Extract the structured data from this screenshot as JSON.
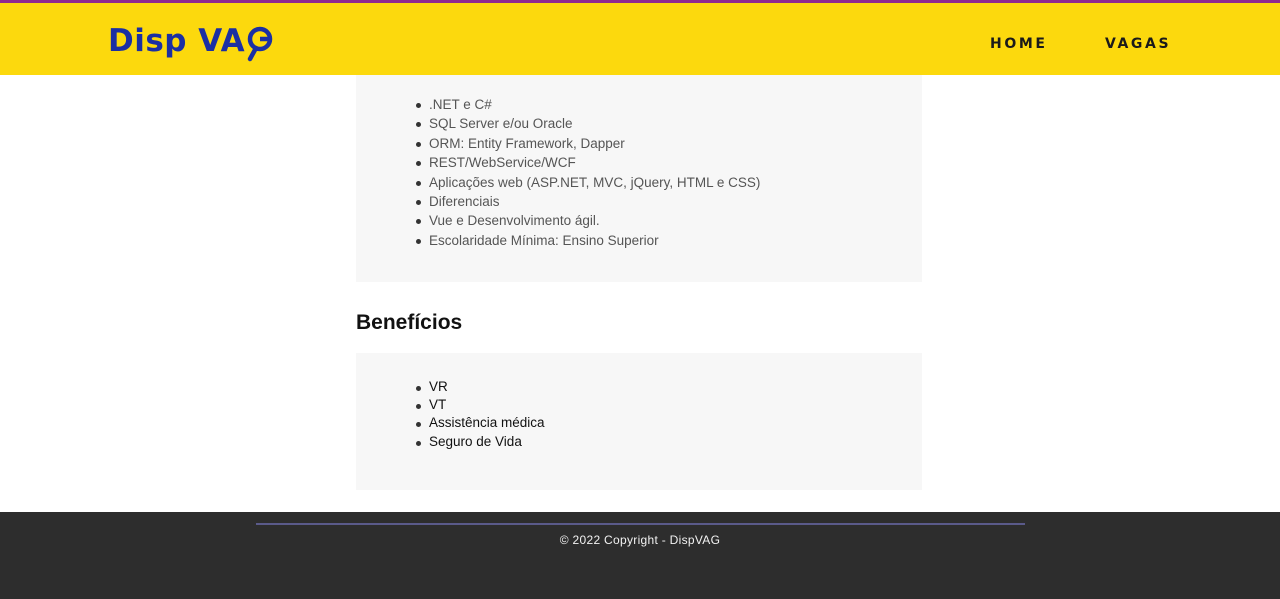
{
  "header": {
    "logo_text": "Disp VA",
    "logo_suffix_icon": "magnifier-g-icon",
    "nav": [
      {
        "label": "HOME"
      },
      {
        "label": "VAGAS"
      }
    ]
  },
  "requirements": {
    "items": [
      ".NET e C#",
      "SQL Server e/ou Oracle",
      "ORM: Entity Framework, Dapper",
      "REST/WebService/WCF",
      "Aplicações web (ASP.NET, MVC, jQuery, HTML e CSS)",
      "Diferenciais",
      "Vue e Desenvolvimento ágil.",
      "Escolaridade Mínima: Ensino Superior"
    ]
  },
  "benefits": {
    "title": "Benefícios",
    "items": [
      "VR",
      "VT",
      "Assistência médica",
      "Seguro de Vida"
    ]
  },
  "footer": {
    "copyright": "© 2022 Copyright - DispVAG"
  },
  "colors": {
    "header_bg": "#fcd90d",
    "brand_blue": "#1b2fa3",
    "top_accent": "#8e2a8f",
    "footer_bg": "#2d2d2d",
    "card_bg": "#f7f7f7"
  }
}
